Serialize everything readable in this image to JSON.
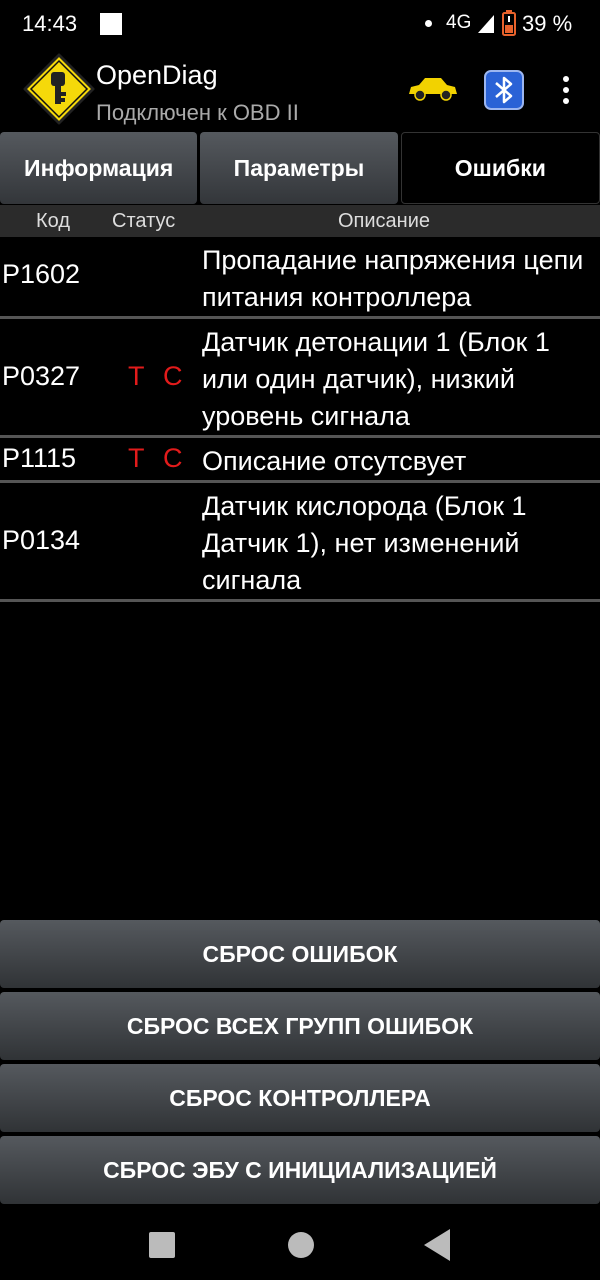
{
  "status_bar": {
    "time": "14:43",
    "network": "4G",
    "battery": "39 %",
    "icons": [
      "notification-square-icon",
      "dot-icon",
      "signal-icon",
      "battery-icon"
    ]
  },
  "app": {
    "title": "OpenDiag",
    "subtitle": "Подключен к OBD II",
    "icons": [
      "app-logo-icon",
      "car-icon",
      "bluetooth-icon",
      "overflow-menu-icon"
    ]
  },
  "tabs": [
    {
      "label": "Информация",
      "active": false
    },
    {
      "label": "Параметры",
      "active": false
    },
    {
      "label": "Ошибки",
      "active": true
    }
  ],
  "columns": {
    "code": "Код",
    "status": "Статус",
    "description": "Описание"
  },
  "errors": [
    {
      "code": "P1602",
      "status_t": "",
      "status_c": "",
      "description": "Пропадание напряжения цепи питания контроллера"
    },
    {
      "code": "P0327",
      "status_t": "T",
      "status_c": "C",
      "description": "Датчик детонации 1 (Блок 1 или один датчик), низкий уровень сигнала"
    },
    {
      "code": "P1115",
      "status_t": "T",
      "status_c": "C",
      "description": "Описание отсутсвует"
    },
    {
      "code": "P0134",
      "status_t": "",
      "status_c": "",
      "description": "Датчик кислорода (Блок 1 Датчик 1), нет изменений сигнала"
    }
  ],
  "actions": {
    "reset_errors": "СБРОС ОШИБОК",
    "reset_all_groups": "СБРОС ВСЕХ ГРУПП ОШИБОК",
    "reset_controller": "СБРОС КОНТРОЛЛЕРА",
    "reset_ecu_init": "СБРОС ЭБУ С ИНИЦИАЛИЗАЦИЕЙ"
  },
  "colors": {
    "status_red": "#e21b1b",
    "logo_yellow": "#f5d90a",
    "car_yellow": "#f2d200",
    "bluetooth_blue": "#2a62d6"
  }
}
